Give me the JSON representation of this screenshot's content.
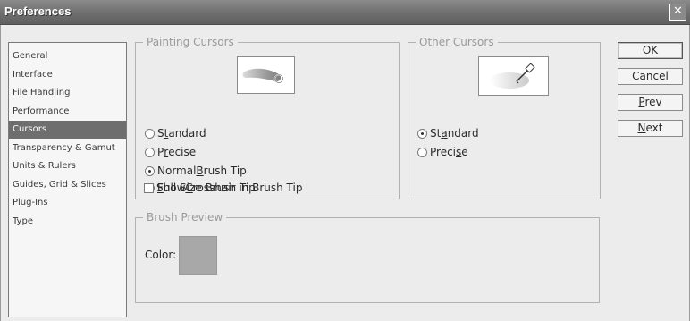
{
  "window": {
    "title": "Preferences",
    "close_glyph": "✕"
  },
  "categories": [
    {
      "label": "General"
    },
    {
      "label": "Interface"
    },
    {
      "label": "File Handling"
    },
    {
      "label": "Performance"
    },
    {
      "label": "Cursors",
      "selected": true
    },
    {
      "label": "Transparency & Gamut"
    },
    {
      "label": "Units & Rulers"
    },
    {
      "label": "Guides, Grid & Slices"
    },
    {
      "label": "Plug-Ins"
    },
    {
      "label": "Type"
    }
  ],
  "painting_cursors": {
    "title": "Painting Cursors",
    "options": [
      {
        "pre": "S",
        "accel": "t",
        "post": "andard",
        "checked": false
      },
      {
        "pre": "P",
        "accel": "r",
        "post": "ecise",
        "checked": false
      },
      {
        "pre": "Normal ",
        "accel": "B",
        "post": "rush Tip",
        "checked": true
      },
      {
        "pre": "",
        "accel": "F",
        "post": "ull Size Brush Tip",
        "checked": false
      }
    ],
    "checkbox": {
      "pre": "Show ",
      "accel": "C",
      "post": "rosshair in Brush Tip",
      "checked": false
    },
    "preview_icon": "brush-stroke-icon"
  },
  "other_cursors": {
    "title": "Other Cursors",
    "options": [
      {
        "pre": "St",
        "accel": "a",
        "post": "ndard",
        "checked": true
      },
      {
        "pre": "Preci",
        "accel": "s",
        "post": "e",
        "checked": false
      }
    ],
    "preview_icon": "eyedropper-icon"
  },
  "brush_preview": {
    "title": "Brush Preview",
    "color_label": "Color:",
    "color": "#a8a8a8"
  },
  "buttons": {
    "ok": "OK",
    "cancel": "Cancel",
    "prev": {
      "accel": "P",
      "post": "rev"
    },
    "next": {
      "accel": "N",
      "post": "ext"
    }
  }
}
